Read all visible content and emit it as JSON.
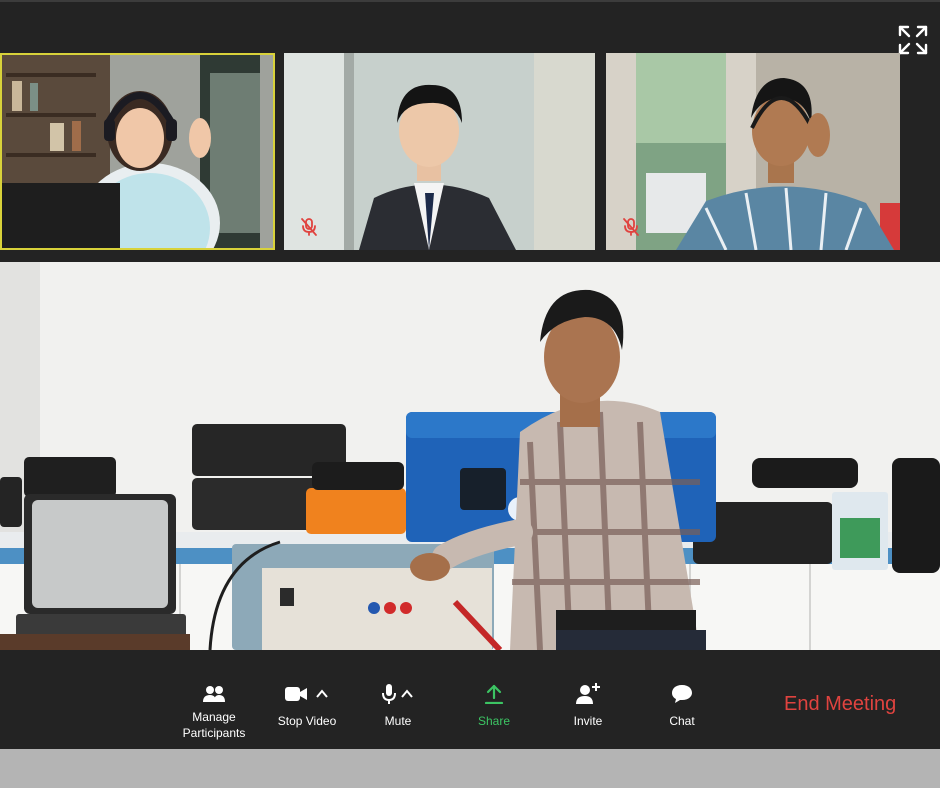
{
  "window": {
    "fullscreen_icon": "expand-arrows-icon"
  },
  "participants": [
    {
      "name": "",
      "active_speaker": true,
      "muted": false,
      "highlight_color": "#d8d23a"
    },
    {
      "name": "",
      "active_speaker": false,
      "muted": true,
      "mute_icon": "mic-off-icon"
    },
    {
      "name": "",
      "active_speaker": false,
      "muted": true,
      "mute_icon": "mic-off-icon"
    }
  ],
  "toolbar": {
    "manage_participants": "Manage\nParticipants",
    "stop_video": "Stop Video",
    "mute": "Mute",
    "share": "Share",
    "invite": "Invite",
    "chat": "Chat",
    "end_meeting": "End Meeting",
    "colors": {
      "share": "#3cc463",
      "end": "#e0433f",
      "bar": "#232323"
    }
  }
}
